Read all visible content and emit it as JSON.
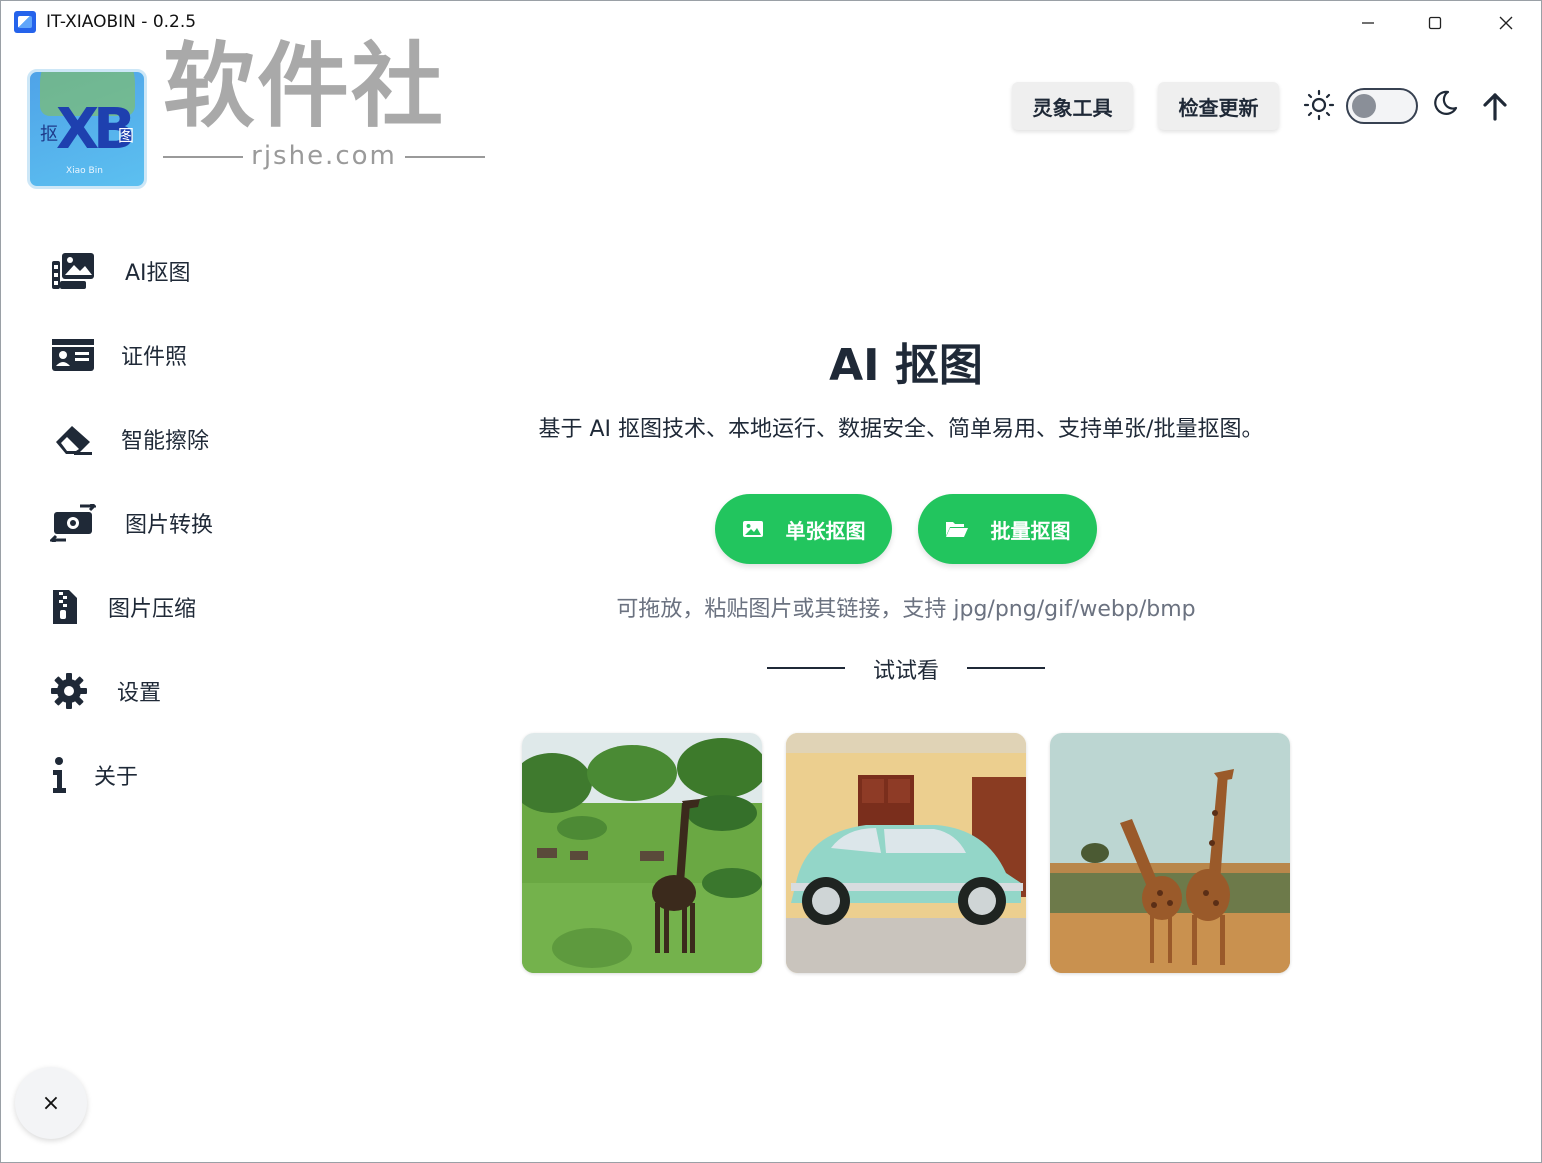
{
  "window": {
    "title": "IT-XIAOBIN - 0.2.5"
  },
  "logo": {
    "letters": "XB",
    "cn_left": "抠",
    "cn_right": "图",
    "en": "Xiao Bin"
  },
  "watermark": {
    "cn": "软件社",
    "en": "rjshe.com"
  },
  "header": {
    "tools_label": "灵象工具",
    "update_label": "检查更新",
    "theme_dark": false
  },
  "sidebar": {
    "items": [
      {
        "label": "AI抠图",
        "icon": "photo-film-icon"
      },
      {
        "label": "证件照",
        "icon": "id-card-icon"
      },
      {
        "label": "智能擦除",
        "icon": "eraser-icon"
      },
      {
        "label": "图片转换",
        "icon": "money-bill-transfer-icon"
      },
      {
        "label": "图片压缩",
        "icon": "file-zipper-icon"
      },
      {
        "label": "设置",
        "icon": "gear-icon"
      },
      {
        "label": "关于",
        "icon": "info-icon"
      }
    ]
  },
  "main": {
    "title": "AI 抠图",
    "description": "基于 AI 抠图技术、本地运行、数据安全、简单易用、支持单张/批量抠图。",
    "single_label": "单张抠图",
    "batch_label": "批量抠图",
    "hint": "可拖放，粘贴图片或其链接，支持 jpg/png/gif/webp/bmp",
    "try_label": "试试看"
  },
  "footer": {
    "close_label": "×"
  },
  "colors": {
    "accent": "#22c55e",
    "text": "#1f2937",
    "muted": "#6b7280"
  }
}
